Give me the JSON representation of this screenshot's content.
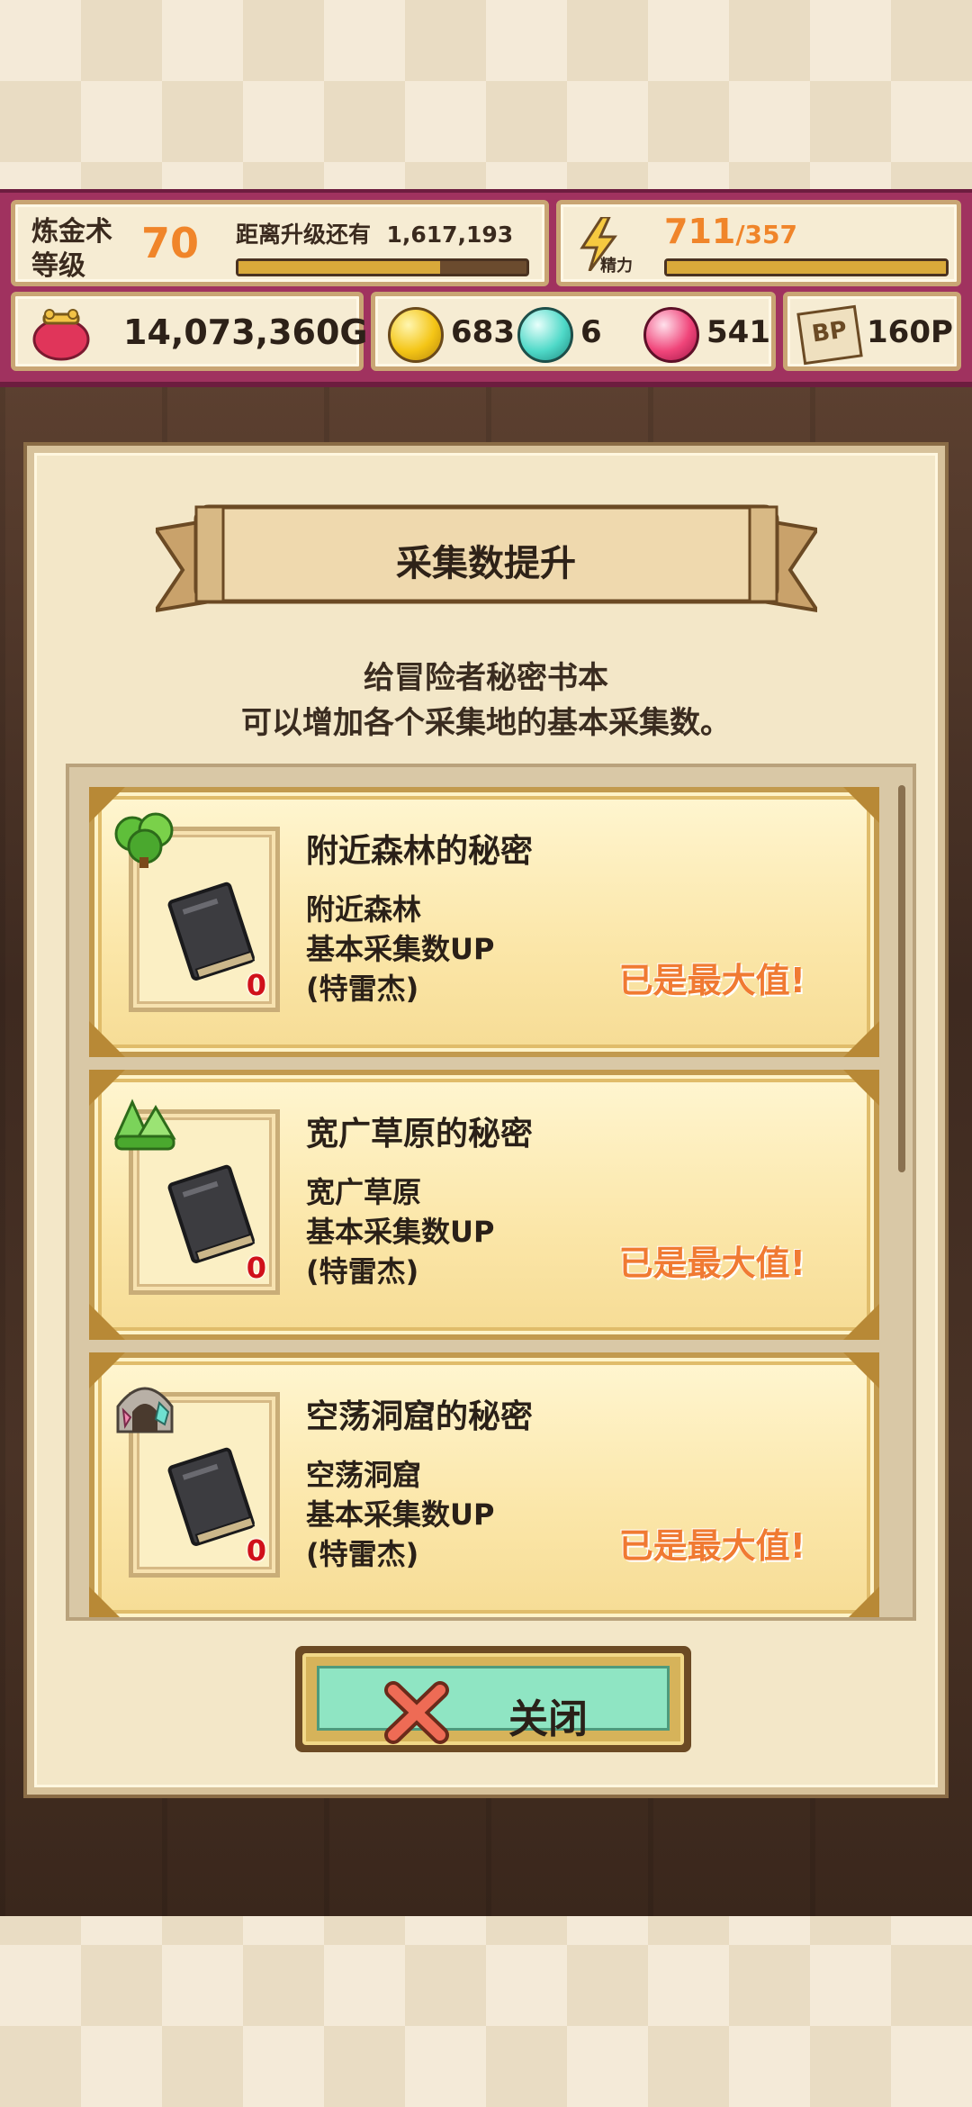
{
  "hud": {
    "level_label": "炼金术\n等级",
    "level": "70",
    "exp_label": "距离升级还有",
    "exp_remaining": "1,617,193",
    "exp_progress": 0.7,
    "stamina_current": "711",
    "stamina_max": "/357",
    "stamina_label": "精力",
    "stamina_progress": 1.0,
    "money": "14,073,360G",
    "yellow_orbs": "683",
    "blue_orbs": "6",
    "pink_orbs": "541",
    "bp_label": "BP",
    "bp": "160P"
  },
  "dialog": {
    "title": "采集数提升",
    "desc_line1": "给冒险者秘密书本",
    "desc_line2": "可以增加各个采集地的基本采集数。",
    "items": [
      {
        "title": "附近森林的秘密",
        "line1": "附近森林",
        "line2": "基本采集数UP",
        "line3": "(特雷杰)",
        "count": "0",
        "status": "已是最大值!",
        "icon": "forest-icon"
      },
      {
        "title": "宽广草原的秘密",
        "line1": "宽广草原",
        "line2": "基本采集数UP",
        "line3": "(特雷杰)",
        "count": "0",
        "status": "已是最大值!",
        "icon": "grassland-icon"
      },
      {
        "title": "空荡洞窟的秘密",
        "line1": "空荡洞窟",
        "line2": "基本采集数UP",
        "line3": "(特雷杰)",
        "count": "0",
        "status": "已是最大值!",
        "icon": "cave-icon"
      }
    ],
    "close_label": "关闭"
  },
  "colors": {
    "hud_bg": "#a0325f",
    "accent_orange": "#f0852a",
    "close_button": "#8fe5c3"
  }
}
